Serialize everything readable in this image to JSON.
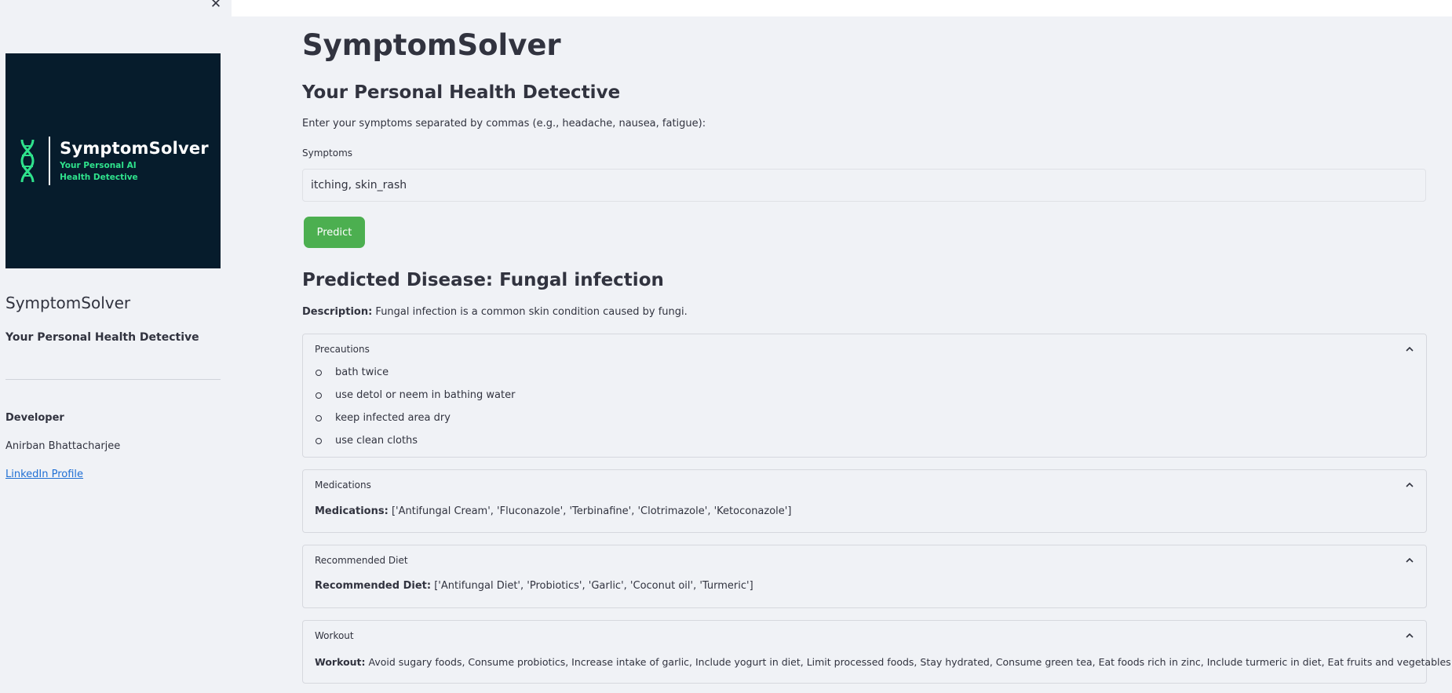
{
  "sidebar": {
    "close_glyph": "✕",
    "logo": {
      "title": "SymptomSolver",
      "subtitle": "Your Personal AI Health Detective",
      "bg_color": "#061c2c",
      "accent_color": "#2fe28c",
      "icon": "dna-icon"
    },
    "title": "SymptomSolver",
    "subtitle": "Your Personal Health Detective",
    "developer_label": "Developer",
    "developer_name": "Anirban Bhattacharjee",
    "link_label": "LinkedIn Profile"
  },
  "main": {
    "title": "SymptomSolver",
    "subtitle": "Your Personal Health Detective",
    "instruction": "Enter your symptoms separated by commas (e.g., headache, nausea, fatigue):",
    "symptoms_label": "Symptoms",
    "symptoms_value": "itching, skin_rash",
    "predict_label": "Predict",
    "predict_color": "#4caf50",
    "predicted_heading": "Predicted Disease: Fungal infection",
    "description_label": "Description:",
    "description_text": "Fungal infection is a common skin condition caused by fungi.",
    "expanders": {
      "precautions": {
        "header": "Precautions",
        "items": [
          "bath twice",
          "use detol or neem in bathing water",
          "keep infected area dry",
          "use clean cloths"
        ]
      },
      "medications": {
        "header": "Medications",
        "label": "Medications:",
        "text": "['Antifungal Cream', 'Fluconazole', 'Terbinafine', 'Clotrimazole', 'Ketoconazole']"
      },
      "diet": {
        "header": "Recommended Diet",
        "label": "Recommended Diet:",
        "text": "['Antifungal Diet', 'Probiotics', 'Garlic', 'Coconut oil', 'Turmeric']"
      },
      "workout": {
        "header": "Workout",
        "label": "Workout:",
        "text": "Avoid sugary foods, Consume probiotics, Increase intake of garlic, Include yogurt in diet, Limit processed foods, Stay hydrated, Consume green tea, Eat foods rich in zinc, Include turmeric in diet, Eat fruits and vegetables"
      }
    }
  }
}
